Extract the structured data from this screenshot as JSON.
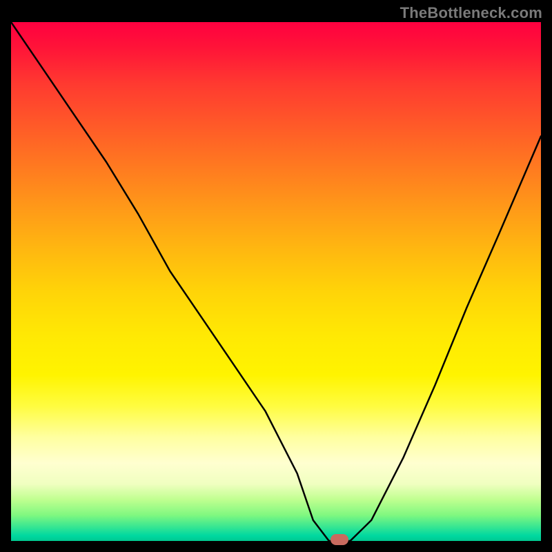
{
  "watermark": "TheBottleneck.com",
  "colors": {
    "page_bg": "#000000",
    "curve": "#000000",
    "marker": "#c96a5f",
    "watermark": "#7a7a7a"
  },
  "chart_data": {
    "type": "line",
    "title": "",
    "xlabel": "",
    "ylabel": "",
    "xlim": [
      0,
      100
    ],
    "ylim": [
      0,
      100
    ],
    "grid": false,
    "legend": false,
    "series": [
      {
        "name": "bottleneck-curve",
        "x": [
          0,
          6,
          12,
          18,
          24,
          30,
          36,
          42,
          48,
          54,
          57,
          60,
          64,
          68,
          74,
          80,
          86,
          92,
          100
        ],
        "values": [
          100,
          91,
          82,
          73,
          63,
          52,
          43,
          34,
          25,
          13,
          4,
          0,
          0,
          4,
          16,
          30,
          45,
          59,
          78
        ]
      }
    ],
    "marker": {
      "x": 62,
      "y": 0
    },
    "gradient_stops": [
      {
        "pos": 0,
        "color": "#ff0040"
      },
      {
        "pos": 50,
        "color": "#ffd000"
      },
      {
        "pos": 85,
        "color": "#ffffc0"
      },
      {
        "pos": 100,
        "color": "#00d090"
      }
    ]
  }
}
